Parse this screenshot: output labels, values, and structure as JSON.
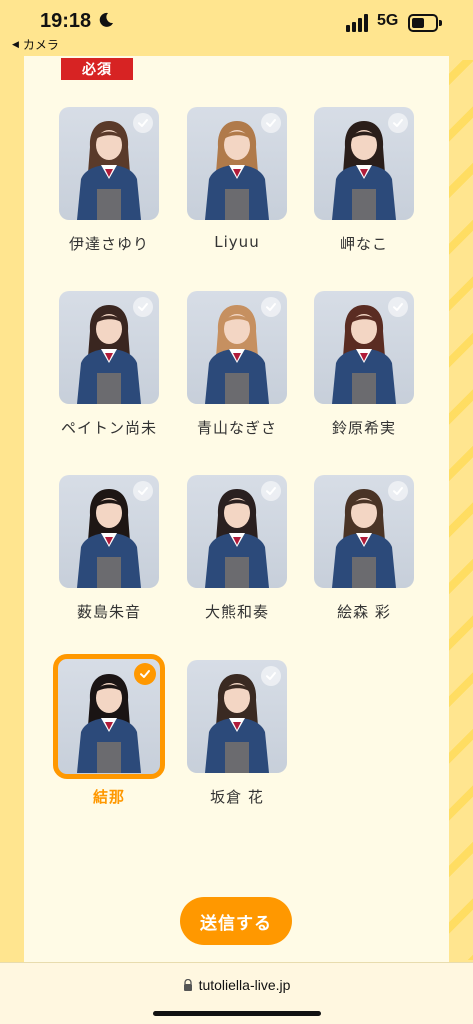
{
  "status": {
    "time": "19:18",
    "back_app": "カメラ",
    "network": "5G"
  },
  "form": {
    "required_label": "必須",
    "members": [
      {
        "name": "伊達さゆり",
        "selected": false
      },
      {
        "name": "Liyuu",
        "selected": false
      },
      {
        "name": "岬なこ",
        "selected": false
      },
      {
        "name": "ペイトン尚未",
        "selected": false
      },
      {
        "name": "青山なぎさ",
        "selected": false
      },
      {
        "name": "鈴原希実",
        "selected": false
      },
      {
        "name": "薮島朱音",
        "selected": false
      },
      {
        "name": "大熊和奏",
        "selected": false
      },
      {
        "name": "絵森 彩",
        "selected": false
      },
      {
        "name": "結那",
        "selected": true
      },
      {
        "name": "坂倉 花",
        "selected": false
      }
    ],
    "submit_label": "送信する"
  },
  "browser": {
    "url": "tutoliella-live.jp"
  },
  "colors": {
    "accent": "#ff9800",
    "required": "#d72323",
    "background": "#ffe58f",
    "panel": "#fffbe6"
  }
}
